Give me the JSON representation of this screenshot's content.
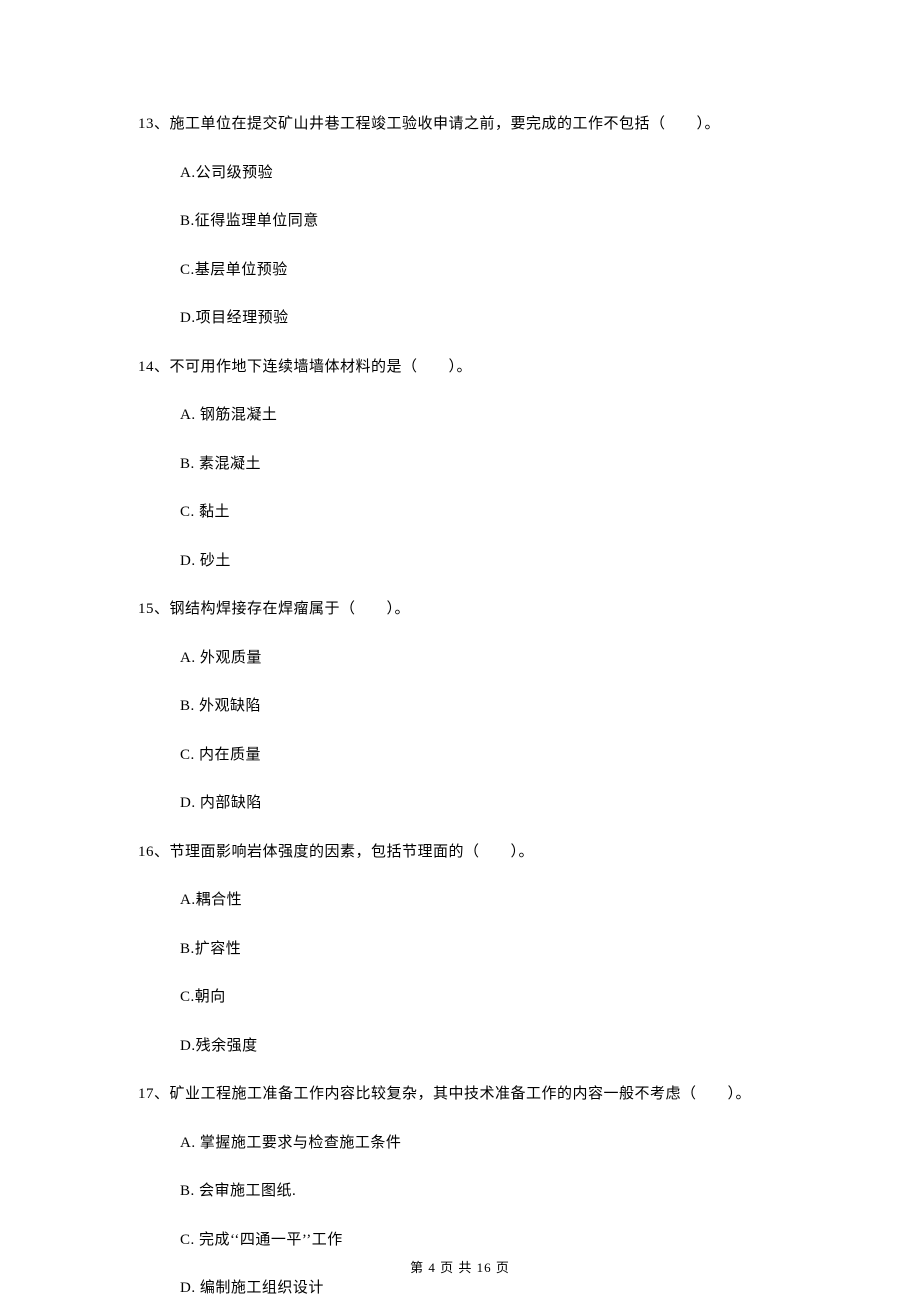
{
  "questions": [
    {
      "stem": "13、施工单位在提交矿山井巷工程竣工验收申请之前，要完成的工作不包括（　　）。",
      "options": [
        "A.公司级预验",
        "B.征得监理单位同意",
        "C.基层单位预验",
        "D.项目经理预验"
      ]
    },
    {
      "stem": "14、不可用作地下连续墙墙体材料的是（　　）。",
      "options": [
        "A.  钢筋混凝土",
        "B.  素混凝土",
        "C.  黏土",
        "D.  砂土"
      ]
    },
    {
      "stem": "15、钢结构焊接存在焊瘤属于（　　）。",
      "options": [
        "A.  外观质量",
        "B.  外观缺陷",
        "C.  内在质量",
        "D.  内部缺陷"
      ]
    },
    {
      "stem": "16、节理面影响岩体强度的因素，包括节理面的（　　）。",
      "options": [
        "A.耦合性",
        "B.扩容性",
        "C.朝向",
        "D.残余强度"
      ]
    },
    {
      "stem": "17、矿业工程施工准备工作内容比较复杂，其中技术准备工作的内容一般不考虑（　　）。",
      "options": [
        "A.  掌握施工要求与检查施工条件",
        "B.  会审施工图纸.",
        "C.  完成‘‘四通一平’’工作",
        "D.  编制施工组织设计"
      ]
    }
  ],
  "footer": "第 4 页 共 16 页"
}
